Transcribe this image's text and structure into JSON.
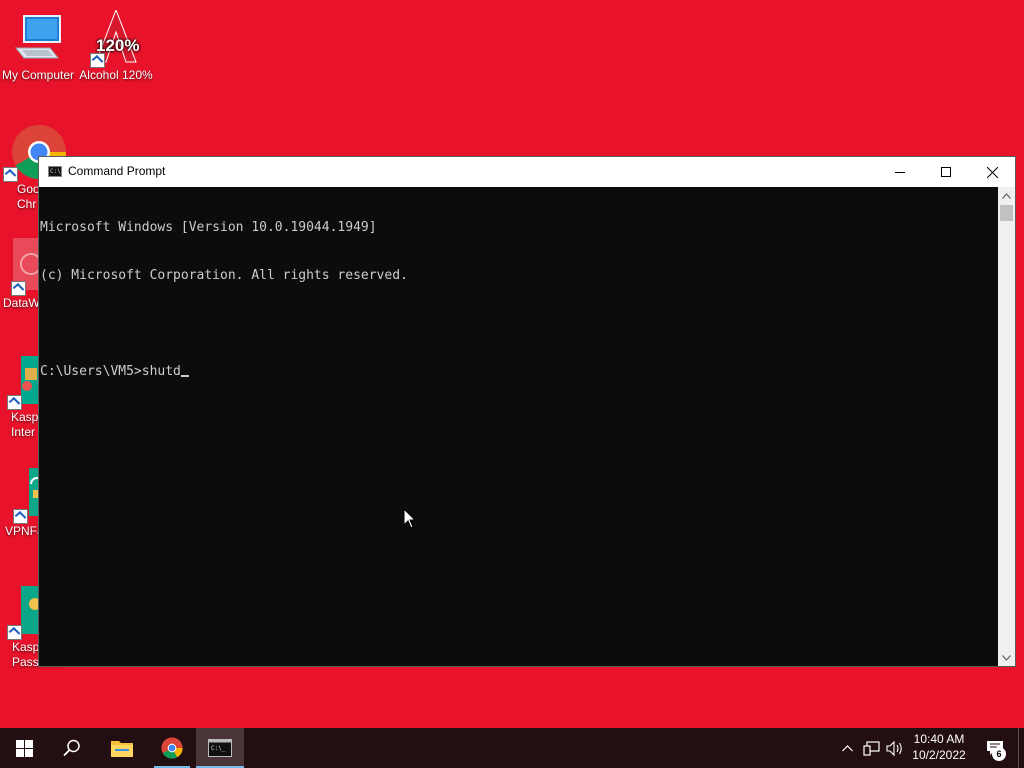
{
  "desktop": {
    "background": "#e8132a",
    "icons": [
      {
        "label": "My Computer",
        "icon": "computer-icon"
      },
      {
        "label": "Alcohol 120%",
        "icon": "alcohol-icon"
      },
      {
        "label": "Goo\nChr",
        "icon": "chrome-icon"
      },
      {
        "label": "DataW",
        "icon": "datawrapper-icon"
      },
      {
        "label": "Kasp\nInter",
        "icon": "kaspersky-internet-icon"
      },
      {
        "label": "VPNFa",
        "icon": "vpn-icon"
      },
      {
        "label": "Kasp\nPasswo...",
        "icon": "kaspersky-password-icon"
      }
    ],
    "alcohol_badge": "120%"
  },
  "window": {
    "title": "Command Prompt",
    "console_lines": [
      "Microsoft Windows [Version 10.0.19044.1949]",
      "(c) Microsoft Corporation. All rights reserved.",
      "",
      "C:\\Users\\VM5>shutd"
    ]
  },
  "taskbar": {
    "background": "#230f12",
    "pinned": [
      "windows-start-icon",
      "search-icon",
      "file-explorer-icon",
      "chrome-icon",
      "command-prompt-icon"
    ],
    "clock_time": "10:40 AM",
    "clock_date": "10/2/2022",
    "notification_count": "6"
  }
}
